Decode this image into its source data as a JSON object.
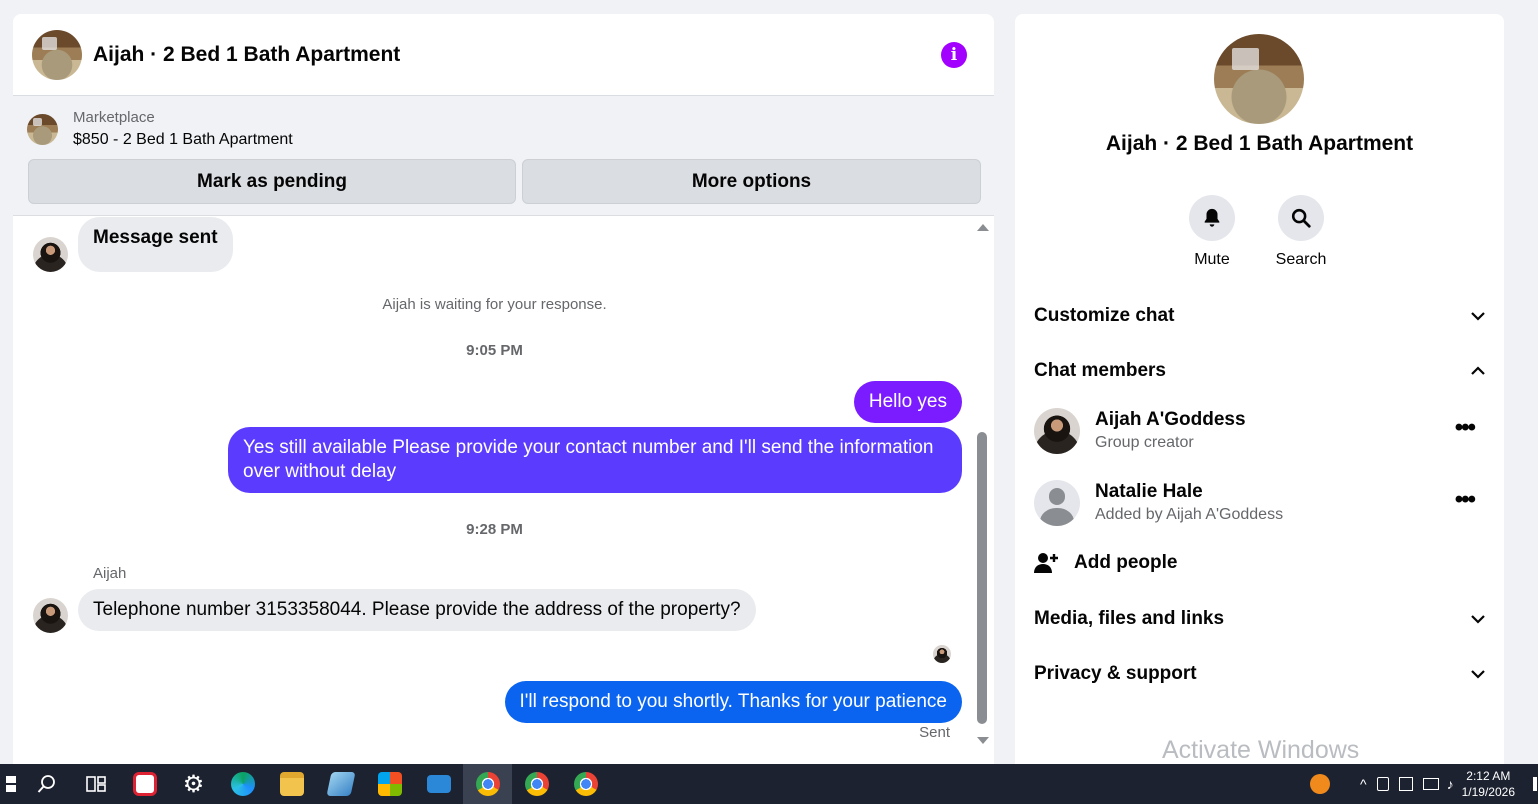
{
  "header": {
    "title": "Aijah · 2 Bed 1 Bath Apartment"
  },
  "marketplace": {
    "label": "Marketplace",
    "listing": "$850 - 2 Bed 1 Bath Apartment",
    "mark_pending": "Mark as pending",
    "more_options": "More options"
  },
  "messages": {
    "m1": "Message sent",
    "waiting": "Aijah is waiting for your response.",
    "time1": "9:05 PM",
    "m2": "Hello yes",
    "m3": "Yes still available Please provide your contact number and I'll send the information over without delay",
    "time2": "9:28 PM",
    "sender": "Aijah",
    "m4": "Telephone number 3153358044. Please provide the address of the property?",
    "m5": "I'll respond to you shortly. Thanks for your patience",
    "status": "Sent"
  },
  "info": {
    "name": "Aijah · 2 Bed 1 Bath Apartment",
    "mute": "Mute",
    "search": "Search",
    "customize": "Customize chat",
    "members_title": "Chat members",
    "members": [
      {
        "name": "Aijah A'Goddess",
        "sub": "Group creator"
      },
      {
        "name": "Natalie Hale",
        "sub": "Added by Aijah A'Goddess"
      }
    ],
    "add_people": "Add people",
    "media": "Media, files and links",
    "privacy": "Privacy & support",
    "watermark": "Activate Windows"
  },
  "taskbar": {
    "time": "2:12 AM",
    "date": "1/19/2026"
  },
  "colors": {
    "accent_purple": "#a200ff",
    "bubble_blue": "#0a64f0",
    "bubble_indigo": "#5b3cff"
  }
}
